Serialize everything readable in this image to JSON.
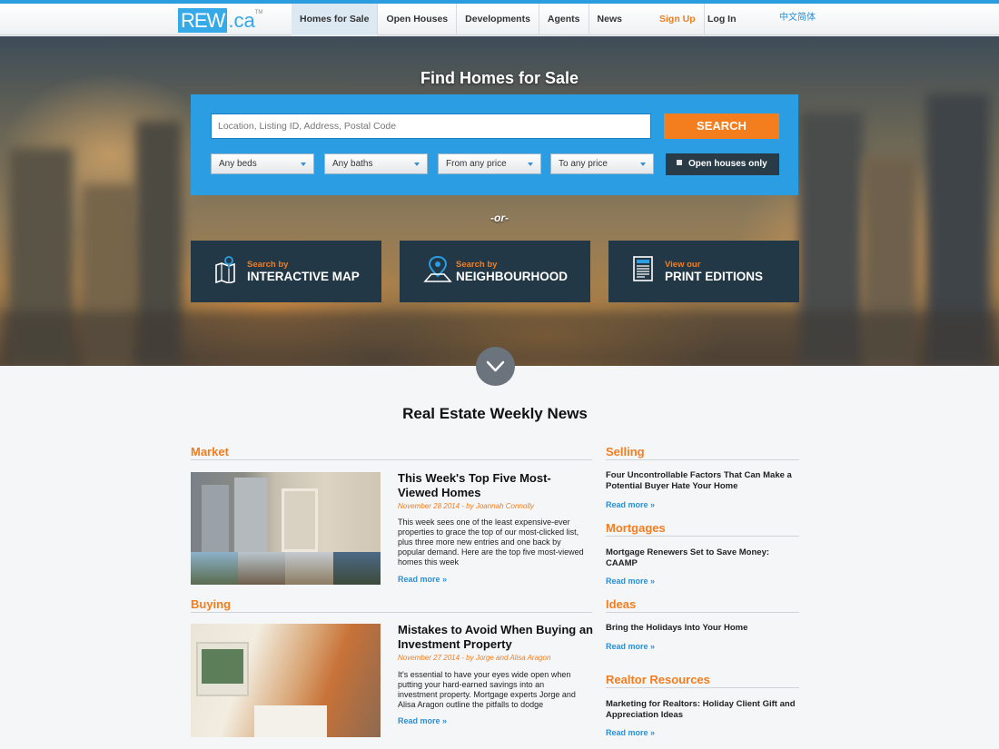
{
  "nav": {
    "logo_rew": "REW",
    "logo_ca": ".ca",
    "logo_tm": "TM",
    "links": [
      "Homes for Sale",
      "Open Houses",
      "Developments",
      "Agents",
      "News"
    ],
    "signup": "Sign Up",
    "login": "Log In",
    "language": "中文简体"
  },
  "hero": {
    "title": "Find Homes for Sale",
    "search_placeholder": "Location, Listing ID, Address, Postal Code",
    "search_button": "SEARCH",
    "filters": [
      "Any beds",
      "Any baths",
      "From any price",
      "To any price"
    ],
    "open_houses": "Open houses only",
    "or_text": "-or-",
    "tiles": [
      {
        "small": "Search by",
        "big": "INTERACTIVE MAP",
        "icon": "map-icon"
      },
      {
        "small": "Search by",
        "big": "NEIGHBOURHOOD",
        "icon": "location-pin-icon"
      },
      {
        "small": "View our",
        "big": "PRINT EDITIONS",
        "icon": "newspaper-icon"
      }
    ]
  },
  "news": {
    "title": "Real Estate Weekly News",
    "main": [
      {
        "section": "Market",
        "title": "This Week's Top Five Most-Viewed Homes",
        "meta": "November 28 2014 - by Joannah Connolly",
        "body": "This week sees one of the least expensive-ever properties to grace the top of our most-clicked list, plus three more new entries and one back by popular demand. Here are the top five most-viewed homes this week",
        "readmore": "Read more »"
      },
      {
        "section": "Buying",
        "title": "Mistakes to Avoid When Buying an Investment Property",
        "meta": "November 27 2014 - by Jorge and Alisa Aragon",
        "body": "It's essential to have your eyes wide open when putting your hard-earned savings into an investment property. Mortgage experts Jorge and Alisa Aragon outline the pitfalls to dodge",
        "readmore": "Read more »"
      }
    ],
    "side": [
      {
        "section": "Selling",
        "title": "Four Uncontrollable Factors That Can Make a Potential Buyer Hate Your Home",
        "readmore": "Read more »"
      },
      {
        "section": "Mortgages",
        "title": "Mortgage Renewers Set to Save Money: CAAMP",
        "readmore": "Read more »"
      },
      {
        "section": "Ideas",
        "title": "Bring the Holidays Into Your Home",
        "readmore": "Read more »"
      },
      {
        "section": "Realtor Resources",
        "title": "Marketing for Realtors: Holiday Client Gift and Appreciation Ideas",
        "readmore": "Read more »"
      }
    ]
  },
  "colors": {
    "brand_blue": "#2b9de2",
    "accent_orange": "#f47d1e",
    "tile_dark": "#233846",
    "link_blue": "#2a8fd6"
  }
}
